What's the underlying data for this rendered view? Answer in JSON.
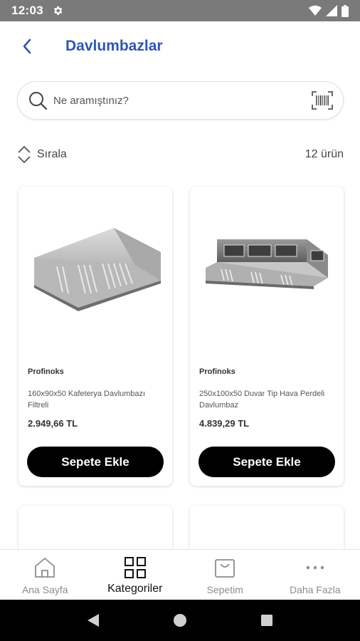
{
  "status_bar": {
    "time": "12:03"
  },
  "header": {
    "title": "Davlumbazlar"
  },
  "search": {
    "placeholder": "Ne aramıştınız?"
  },
  "toolbar": {
    "sort_label": "Sırala",
    "count_label": "12 ürün"
  },
  "products": [
    {
      "brand": "Profinoks",
      "name": "160x90x50 Kafeterya Davlumbazı Filtreli",
      "price": "2.949,66 TL",
      "button": "Sepete Ekle"
    },
    {
      "brand": "Profinoks",
      "name": "250x100x50 Duvar Tip Hava Perdeli Davlumbaz",
      "price": "4.839,29 TL",
      "button": "Sepete Ekle"
    }
  ],
  "bottom_nav": {
    "items": [
      {
        "label": "Ana Sayfa",
        "icon": "home-icon"
      },
      {
        "label": "Kategoriler",
        "icon": "grid-icon",
        "active": true
      },
      {
        "label": "Sepetim",
        "icon": "cart-icon"
      },
      {
        "label": "Daha Fazla",
        "icon": "more-icon"
      }
    ]
  },
  "colors": {
    "accent": "#2f56b3",
    "button_bg": "#000000",
    "status_bar": "#7a7a7a"
  }
}
